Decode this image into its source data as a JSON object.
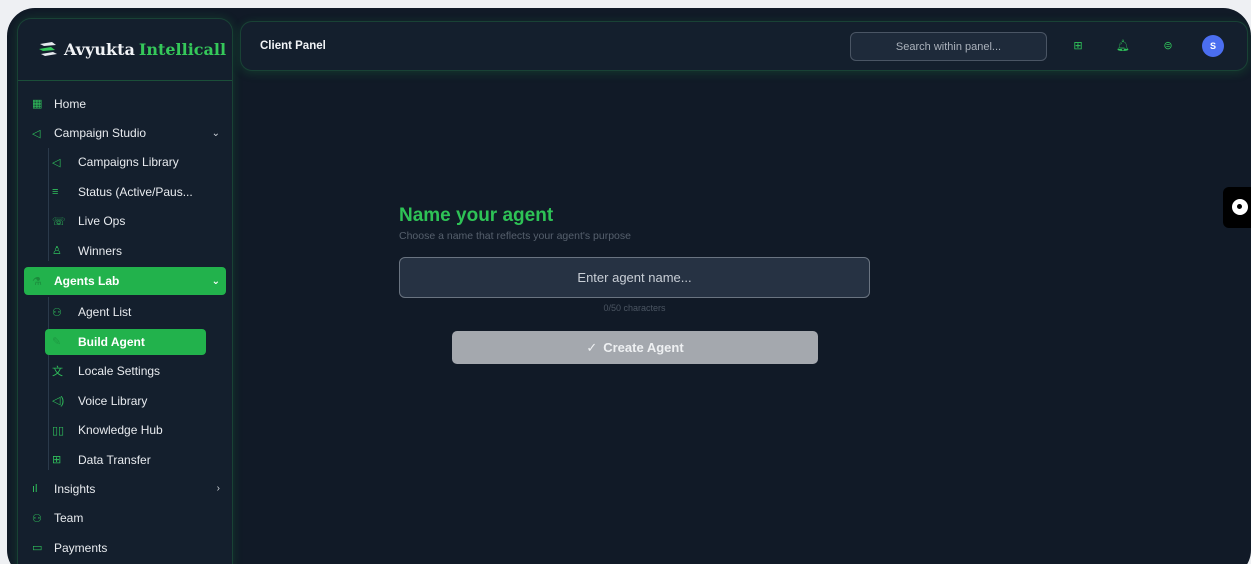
{
  "brand": {
    "name_part1": "Avyukta",
    "name_part2": "Intellicall",
    "logo_icon": "stacked-lines-icon"
  },
  "sidebar": {
    "items": [
      {
        "label": "Home",
        "icon": "grid-icon"
      },
      {
        "label": "Campaign Studio",
        "icon": "megaphone-icon",
        "expanded": true
      },
      {
        "label": "Campaigns Library",
        "icon": "megaphone-icon"
      },
      {
        "label": "Status (Active/Paus...",
        "icon": "filter-icon"
      },
      {
        "label": "Live Ops",
        "icon": "phone-icon"
      },
      {
        "label": "Winners",
        "icon": "award-icon"
      },
      {
        "label": "Agents Lab",
        "icon": "flask-icon",
        "expanded": true
      },
      {
        "label": "Agent List",
        "icon": "users-icon"
      },
      {
        "label": "Build Agent",
        "icon": "wrench-icon",
        "active": true
      },
      {
        "label": "Locale Settings",
        "icon": "translate-icon"
      },
      {
        "label": "Voice Library",
        "icon": "speaker-icon"
      },
      {
        "label": "Knowledge Hub",
        "icon": "book-icon"
      },
      {
        "label": "Data Transfer",
        "icon": "download-icon"
      },
      {
        "label": "Insights",
        "icon": "bar-chart-icon",
        "expanded": false
      },
      {
        "label": "Team",
        "icon": "users-icon"
      },
      {
        "label": "Payments",
        "icon": "card-icon"
      }
    ]
  },
  "topbar": {
    "title": "Client Panel",
    "search_placeholder": "Search within panel...",
    "avatar_initial": "S",
    "icons": [
      "plus-square-icon",
      "bell-icon",
      "globe-icon"
    ]
  },
  "main": {
    "heading": "Name your agent",
    "subtext": "Choose a name that reflects your agent's purpose",
    "input_placeholder": "Enter agent name...",
    "input_value": "",
    "counter": "0/50 characters",
    "create_label": "Create Agent"
  },
  "colors": {
    "accent": "#22b24c",
    "background": "#111a27",
    "panel": "#141f2d",
    "button_disabled": "#a4a8ae",
    "avatar": "#4b6ef0"
  }
}
